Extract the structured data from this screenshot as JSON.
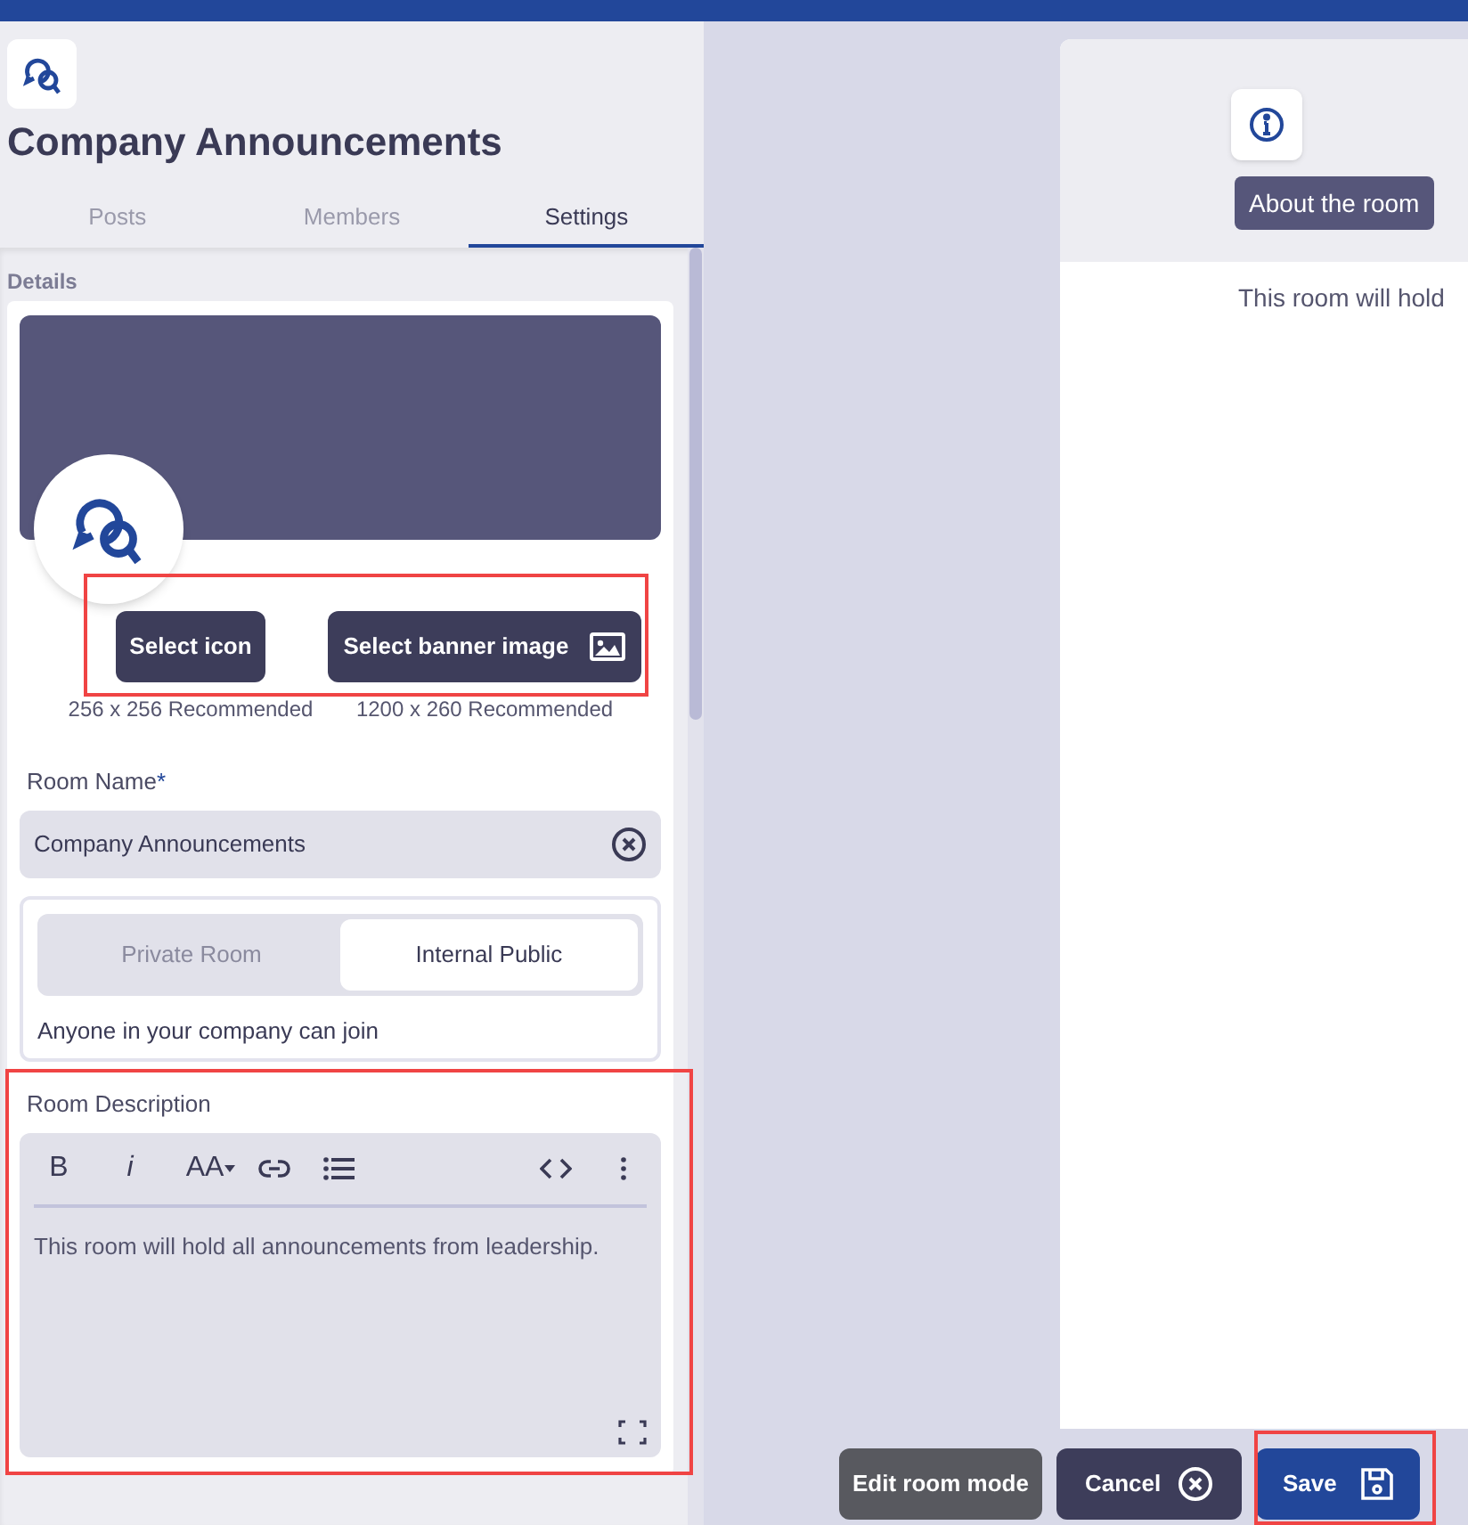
{
  "header": {
    "title": "Company Announcements"
  },
  "tabs": [
    {
      "label": "Posts",
      "selected": false
    },
    {
      "label": "Members",
      "selected": false
    },
    {
      "label": "Settings",
      "selected": true
    }
  ],
  "section_label": "Details",
  "icon_button": {
    "label": "Select icon",
    "caption": "256 x 256 Recommended"
  },
  "banner_button": {
    "label": "Select banner image",
    "caption": "1200 x 260 Recommended"
  },
  "room_name": {
    "label": "Room Name",
    "required_mark": "*",
    "value": "Company Announcements"
  },
  "access": {
    "options": [
      {
        "label": "Private Room",
        "selected": false
      },
      {
        "label": "Internal Public",
        "selected": true
      }
    ],
    "hint": "Anyone in your company can join"
  },
  "description": {
    "label": "Room Description",
    "toolbar": [
      {
        "kind": "bold",
        "label": "B"
      },
      {
        "kind": "italic",
        "label": "i"
      },
      {
        "kind": "font-size",
        "label": "AA"
      },
      {
        "kind": "link"
      },
      {
        "kind": "list"
      },
      {
        "kind": "code"
      },
      {
        "kind": "more"
      }
    ],
    "value": "This room will hold all announcements from leadership."
  },
  "about": {
    "label": "About the room",
    "text": "This room will hold"
  },
  "footer_buttons": [
    {
      "kind": "secondary",
      "label": "Edit room mode"
    },
    {
      "kind": "cancel",
      "label": "Cancel"
    },
    {
      "kind": "primary",
      "label": "Save"
    }
  ]
}
